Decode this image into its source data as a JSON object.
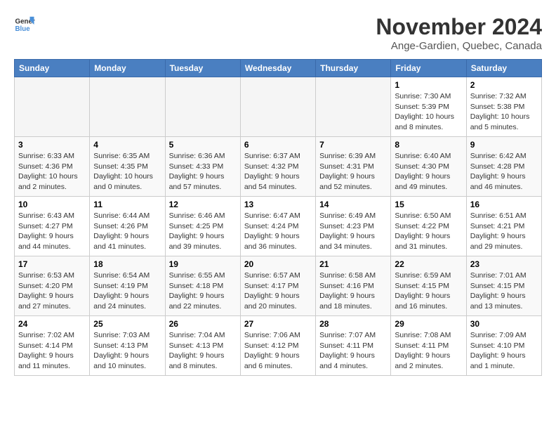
{
  "header": {
    "logo_line1": "General",
    "logo_line2": "Blue",
    "month": "November 2024",
    "location": "Ange-Gardien, Quebec, Canada"
  },
  "days_of_week": [
    "Sunday",
    "Monday",
    "Tuesday",
    "Wednesday",
    "Thursday",
    "Friday",
    "Saturday"
  ],
  "weeks": [
    [
      {
        "day": "",
        "empty": true
      },
      {
        "day": "",
        "empty": true
      },
      {
        "day": "",
        "empty": true
      },
      {
        "day": "",
        "empty": true
      },
      {
        "day": "",
        "empty": true
      },
      {
        "day": "1",
        "sunrise": "7:30 AM",
        "sunset": "5:39 PM",
        "daylight": "10 hours and 8 minutes."
      },
      {
        "day": "2",
        "sunrise": "7:32 AM",
        "sunset": "5:38 PM",
        "daylight": "10 hours and 5 minutes."
      }
    ],
    [
      {
        "day": "3",
        "sunrise": "6:33 AM",
        "sunset": "4:36 PM",
        "daylight": "10 hours and 2 minutes."
      },
      {
        "day": "4",
        "sunrise": "6:35 AM",
        "sunset": "4:35 PM",
        "daylight": "10 hours and 0 minutes."
      },
      {
        "day": "5",
        "sunrise": "6:36 AM",
        "sunset": "4:33 PM",
        "daylight": "9 hours and 57 minutes."
      },
      {
        "day": "6",
        "sunrise": "6:37 AM",
        "sunset": "4:32 PM",
        "daylight": "9 hours and 54 minutes."
      },
      {
        "day": "7",
        "sunrise": "6:39 AM",
        "sunset": "4:31 PM",
        "daylight": "9 hours and 52 minutes."
      },
      {
        "day": "8",
        "sunrise": "6:40 AM",
        "sunset": "4:30 PM",
        "daylight": "9 hours and 49 minutes."
      },
      {
        "day": "9",
        "sunrise": "6:42 AM",
        "sunset": "4:28 PM",
        "daylight": "9 hours and 46 minutes."
      }
    ],
    [
      {
        "day": "10",
        "sunrise": "6:43 AM",
        "sunset": "4:27 PM",
        "daylight": "9 hours and 44 minutes."
      },
      {
        "day": "11",
        "sunrise": "6:44 AM",
        "sunset": "4:26 PM",
        "daylight": "9 hours and 41 minutes."
      },
      {
        "day": "12",
        "sunrise": "6:46 AM",
        "sunset": "4:25 PM",
        "daylight": "9 hours and 39 minutes."
      },
      {
        "day": "13",
        "sunrise": "6:47 AM",
        "sunset": "4:24 PM",
        "daylight": "9 hours and 36 minutes."
      },
      {
        "day": "14",
        "sunrise": "6:49 AM",
        "sunset": "4:23 PM",
        "daylight": "9 hours and 34 minutes."
      },
      {
        "day": "15",
        "sunrise": "6:50 AM",
        "sunset": "4:22 PM",
        "daylight": "9 hours and 31 minutes."
      },
      {
        "day": "16",
        "sunrise": "6:51 AM",
        "sunset": "4:21 PM",
        "daylight": "9 hours and 29 minutes."
      }
    ],
    [
      {
        "day": "17",
        "sunrise": "6:53 AM",
        "sunset": "4:20 PM",
        "daylight": "9 hours and 27 minutes."
      },
      {
        "day": "18",
        "sunrise": "6:54 AM",
        "sunset": "4:19 PM",
        "daylight": "9 hours and 24 minutes."
      },
      {
        "day": "19",
        "sunrise": "6:55 AM",
        "sunset": "4:18 PM",
        "daylight": "9 hours and 22 minutes."
      },
      {
        "day": "20",
        "sunrise": "6:57 AM",
        "sunset": "4:17 PM",
        "daylight": "9 hours and 20 minutes."
      },
      {
        "day": "21",
        "sunrise": "6:58 AM",
        "sunset": "4:16 PM",
        "daylight": "9 hours and 18 minutes."
      },
      {
        "day": "22",
        "sunrise": "6:59 AM",
        "sunset": "4:15 PM",
        "daylight": "9 hours and 16 minutes."
      },
      {
        "day": "23",
        "sunrise": "7:01 AM",
        "sunset": "4:15 PM",
        "daylight": "9 hours and 13 minutes."
      }
    ],
    [
      {
        "day": "24",
        "sunrise": "7:02 AM",
        "sunset": "4:14 PM",
        "daylight": "9 hours and 11 minutes."
      },
      {
        "day": "25",
        "sunrise": "7:03 AM",
        "sunset": "4:13 PM",
        "daylight": "9 hours and 10 minutes."
      },
      {
        "day": "26",
        "sunrise": "7:04 AM",
        "sunset": "4:13 PM",
        "daylight": "9 hours and 8 minutes."
      },
      {
        "day": "27",
        "sunrise": "7:06 AM",
        "sunset": "4:12 PM",
        "daylight": "9 hours and 6 minutes."
      },
      {
        "day": "28",
        "sunrise": "7:07 AM",
        "sunset": "4:11 PM",
        "daylight": "9 hours and 4 minutes."
      },
      {
        "day": "29",
        "sunrise": "7:08 AM",
        "sunset": "4:11 PM",
        "daylight": "9 hours and 2 minutes."
      },
      {
        "day": "30",
        "sunrise": "7:09 AM",
        "sunset": "4:10 PM",
        "daylight": "9 hours and 1 minute."
      }
    ]
  ]
}
